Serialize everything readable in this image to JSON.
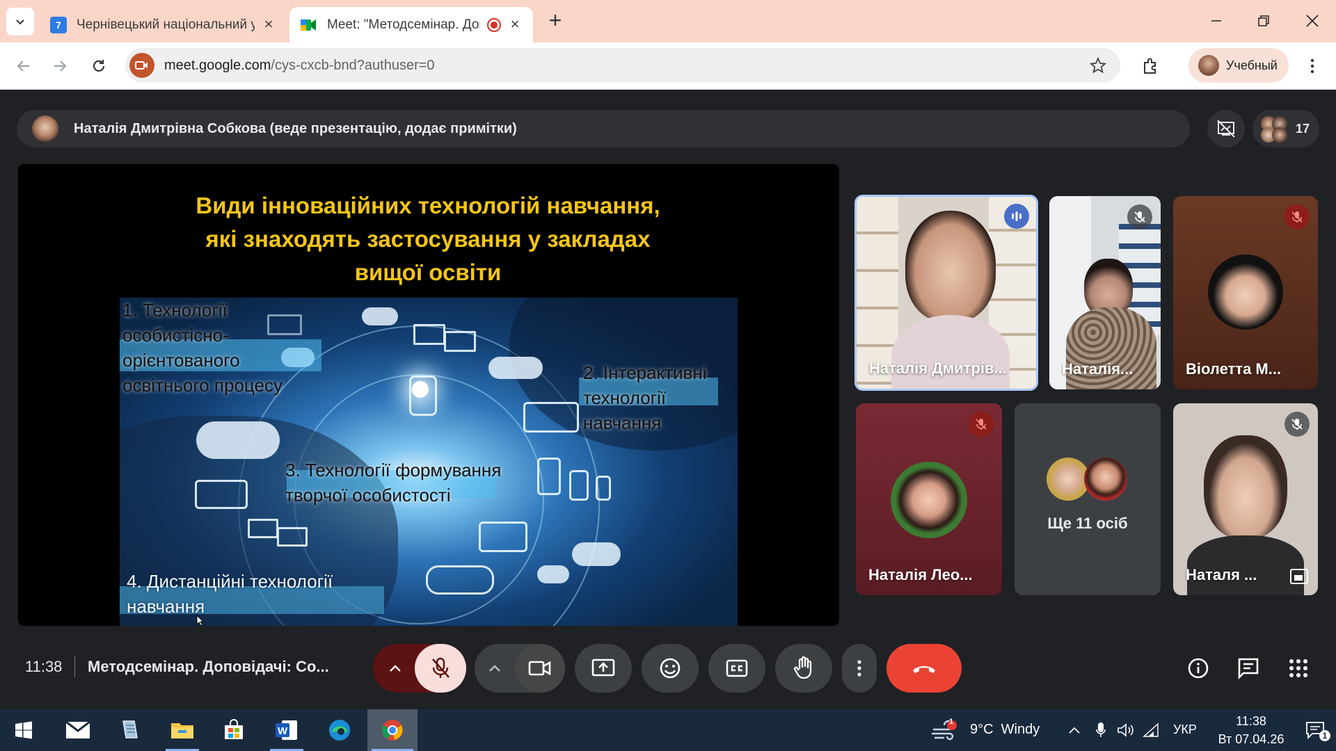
{
  "browser": {
    "tabs": [
      {
        "title": "Чернівецький національний у",
        "favicon_label": "7"
      },
      {
        "title": "Meet: \"Методсемінар. Доп",
        "recording": true
      }
    ],
    "new_tab_label": "+",
    "url_host": "meet.google.com",
    "url_path": "/cys-cxcb-bnd?authuser=0",
    "profile_name": "Учебный"
  },
  "meet": {
    "presenter_text": "Наталія Дмитрівна Собкова (веде презентацію, додає примітки)",
    "participant_count": "17",
    "slide": {
      "title_lines": [
        "Види інноваційних технологій навчання,",
        "які знаходять застосування у закладах",
        "вищої освіти"
      ],
      "item1": [
        "1. Технології",
        "особистісно-",
        "орієнтованого",
        "освітнього процесу"
      ],
      "item2": [
        "2. Інтерактивні",
        "технології",
        "навчання"
      ],
      "item3": [
        "3. Технології формування",
        "творчої особистості"
      ],
      "item4": [
        "4. Дистанційні технології",
        "навчання"
      ]
    },
    "participants": [
      {
        "name": "Наталія Дмитрів...",
        "mic": "speaking"
      },
      {
        "name": "Наталія...",
        "mic": "muted"
      },
      {
        "name": "Віолетта М...",
        "mic": "muted"
      },
      {
        "name": "Наталія Лео...",
        "mic": "muted"
      },
      {
        "name": "Ще 11 осіб"
      },
      {
        "name": "Наталя ...",
        "mic": "muted"
      }
    ],
    "time": "11:38",
    "meeting_title": "Методсемінар. Доповідачі: Со..."
  },
  "taskbar": {
    "weather": "9°C  Windy",
    "weather_badge": "1",
    "language": "УКР",
    "clock_time": "11:38",
    "clock_date": "Вт 07.04.26",
    "notification_count": "1"
  },
  "colors": {
    "tab_strip": "#f9d6c8",
    "slide_title": "#f5c518",
    "end_call": "#ea4335",
    "mic_muted_bg": "#f9dedc",
    "meet_bg": "#202124"
  }
}
